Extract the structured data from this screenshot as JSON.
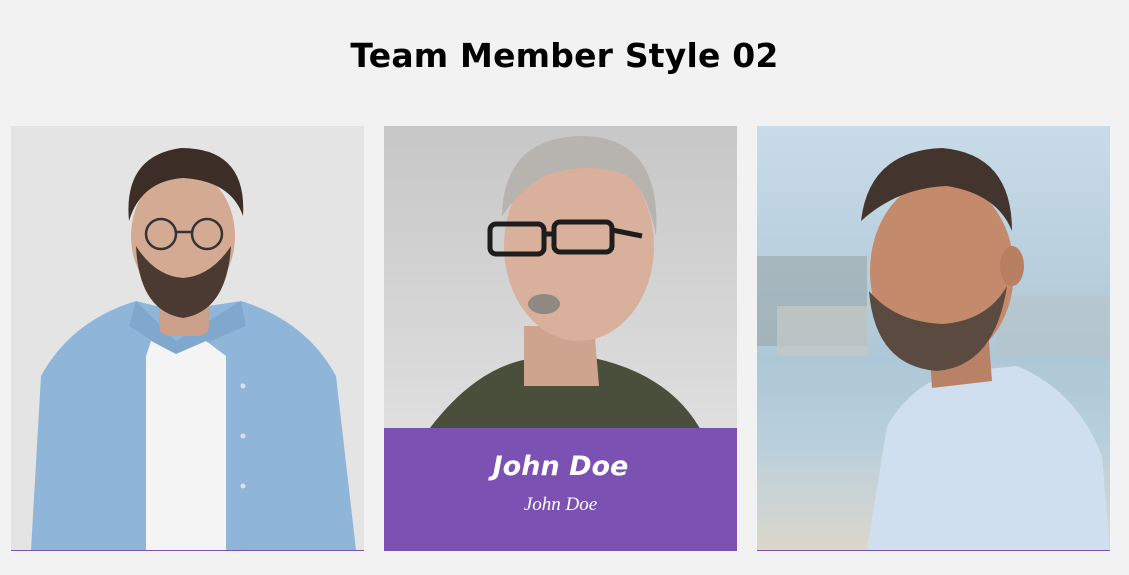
{
  "page": {
    "title": "Team Member Style 02"
  },
  "team": [
    {
      "name": "",
      "role": ""
    },
    {
      "name": "John Doe",
      "role": "John Doe"
    },
    {
      "name": "",
      "role": ""
    }
  ],
  "colors": {
    "background": "#f2f2f2",
    "accent": "#7b51b3"
  }
}
